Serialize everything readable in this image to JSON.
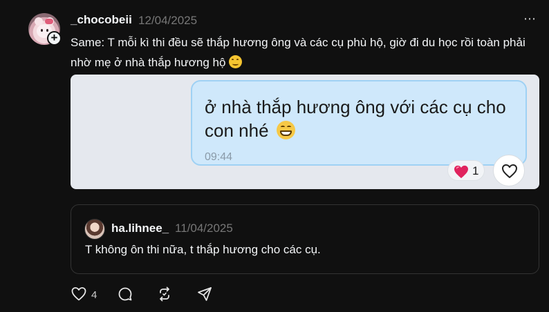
{
  "post": {
    "author": "_chocobeii",
    "date": "12/04/2025",
    "text": "Same: T mỗi kì thi đều sẽ thắp hương ông và các cụ phù hộ, giờ đi du học rồi toàn phải nhờ mẹ ở nhà thắp hương hộ",
    "text_emoji": "hugging-face-icon",
    "more_menu": "⋯",
    "follow_badge": "+",
    "like_count": "4"
  },
  "image": {
    "message_text": "ở nhà thắp hương ông với các cụ cho con nhé",
    "message_emoji": "grinning-face-icon",
    "message_time": "09:44",
    "reaction_count": "1",
    "reaction_icon": "red-heart-icon"
  },
  "quote": {
    "author": "ha.lihnee_",
    "date": "11/04/2025",
    "text": "T không ôn thi nữa, t thắp hương cho các cụ."
  },
  "colors": {
    "background": "#101010",
    "text": "#f3f5f7",
    "muted": "#777777",
    "bubble": "#cfe8fb",
    "reaction_heart": "#e0245e"
  }
}
